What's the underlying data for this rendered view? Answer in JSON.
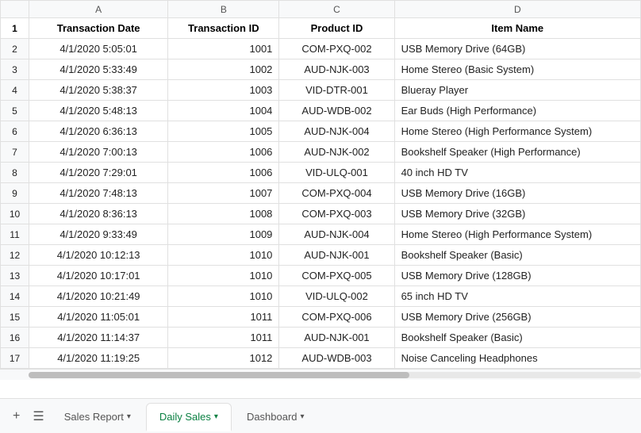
{
  "columns": {
    "letters": [
      "",
      "A",
      "B",
      "C",
      "D"
    ],
    "headers": [
      "",
      "Transaction Date",
      "Transaction ID",
      "Product ID",
      "Item Name"
    ]
  },
  "rows": [
    {
      "num": 2,
      "date": "4/1/2020 5:05:01",
      "tid": "1001",
      "pid": "COM-PXQ-002",
      "name": "USB Memory Drive (64GB)"
    },
    {
      "num": 3,
      "date": "4/1/2020 5:33:49",
      "tid": "1002",
      "pid": "AUD-NJK-003",
      "name": "Home Stereo (Basic System)"
    },
    {
      "num": 4,
      "date": "4/1/2020 5:38:37",
      "tid": "1003",
      "pid": "VID-DTR-001",
      "name": "Blueray Player"
    },
    {
      "num": 5,
      "date": "4/1/2020 5:48:13",
      "tid": "1004",
      "pid": "AUD-WDB-002",
      "name": "Ear Buds (High Performance)"
    },
    {
      "num": 6,
      "date": "4/1/2020 6:36:13",
      "tid": "1005",
      "pid": "AUD-NJK-004",
      "name": "Home Stereo (High Performance System)"
    },
    {
      "num": 7,
      "date": "4/1/2020 7:00:13",
      "tid": "1006",
      "pid": "AUD-NJK-002",
      "name": "Bookshelf Speaker (High Performance)"
    },
    {
      "num": 8,
      "date": "4/1/2020 7:29:01",
      "tid": "1006",
      "pid": "VID-ULQ-001",
      "name": "40 inch HD TV"
    },
    {
      "num": 9,
      "date": "4/1/2020 7:48:13",
      "tid": "1007",
      "pid": "COM-PXQ-004",
      "name": "USB Memory Drive (16GB)"
    },
    {
      "num": 10,
      "date": "4/1/2020 8:36:13",
      "tid": "1008",
      "pid": "COM-PXQ-003",
      "name": "USB Memory Drive (32GB)"
    },
    {
      "num": 11,
      "date": "4/1/2020 9:33:49",
      "tid": "1009",
      "pid": "AUD-NJK-004",
      "name": "Home Stereo (High Performance System)"
    },
    {
      "num": 12,
      "date": "4/1/2020 10:12:13",
      "tid": "1010",
      "pid": "AUD-NJK-001",
      "name": "Bookshelf Speaker (Basic)"
    },
    {
      "num": 13,
      "date": "4/1/2020 10:17:01",
      "tid": "1010",
      "pid": "COM-PXQ-005",
      "name": "USB Memory Drive (128GB)"
    },
    {
      "num": 14,
      "date": "4/1/2020 10:21:49",
      "tid": "1010",
      "pid": "VID-ULQ-002",
      "name": "65 inch HD TV"
    },
    {
      "num": 15,
      "date": "4/1/2020 11:05:01",
      "tid": "1011",
      "pid": "COM-PXQ-006",
      "name": "USB Memory Drive (256GB)"
    },
    {
      "num": 16,
      "date": "4/1/2020 11:14:37",
      "tid": "1011",
      "pid": "AUD-NJK-001",
      "name": "Bookshelf Speaker (Basic)"
    },
    {
      "num": 17,
      "date": "4/1/2020 11:19:25",
      "tid": "1012",
      "pid": "AUD-WDB-003",
      "name": "Noise Canceling Headphones"
    }
  ],
  "tabs": [
    {
      "id": "sales-report",
      "label": "Sales Report",
      "active": false
    },
    {
      "id": "daily-sales",
      "label": "Daily Sales",
      "active": true
    },
    {
      "id": "dashboard",
      "label": "Dashboard",
      "active": false
    }
  ],
  "tab_add_label": "+",
  "tab_list_label": "☰"
}
